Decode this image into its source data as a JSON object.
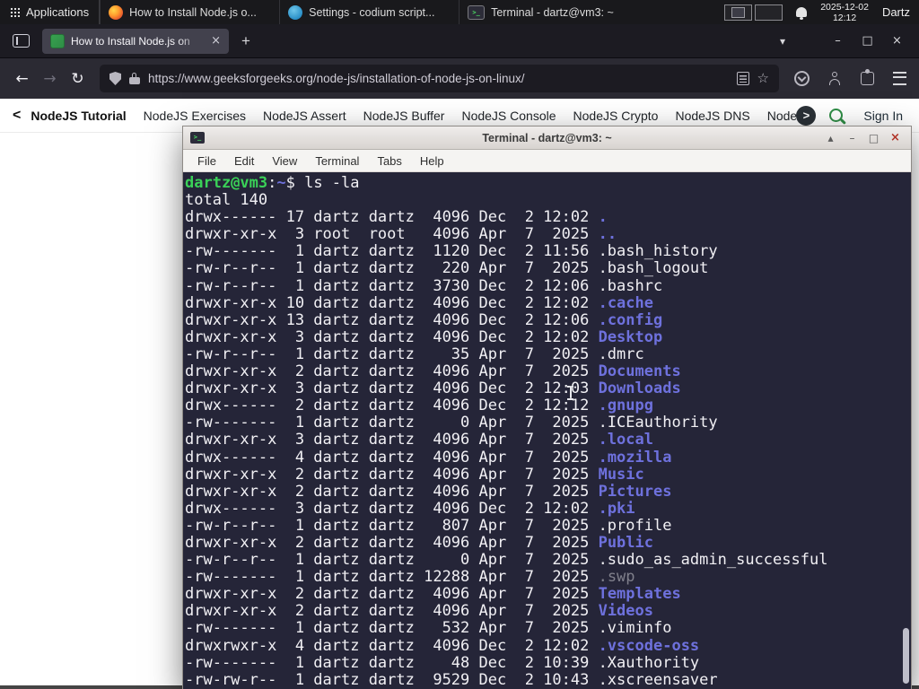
{
  "colors": {
    "accent_green": "#2f8d46",
    "terminal_bg": "#252538",
    "terminal_dir_blue": "#6e71dd",
    "terminal_prompt_green": "#3ad158",
    "panel_bg": "#19191c"
  },
  "icons": {
    "back": "←",
    "forward": "→",
    "reload": "↻",
    "star": "☆",
    "new_tab": "+",
    "tab_list": "▾",
    "minimize": "–",
    "restore": "□",
    "close": "×",
    "shade": "▴",
    "nav_prev": "<",
    "nav_next": ">",
    "prompt_glyph": ">_"
  },
  "top_panel": {
    "applications_label": "Applications",
    "tasks": [
      {
        "icon": "firefox",
        "label": "How to Install Node.js o..."
      },
      {
        "icon": "codium",
        "label": "Settings - codium script..."
      },
      {
        "icon": "terminal",
        "label": "Terminal - dartz@vm3: ~"
      }
    ],
    "clock_date": "2025-12-02",
    "clock_time": "12:12",
    "user": "Dartz"
  },
  "browser": {
    "tab_title": "How to Install Node.js on",
    "url": "https://www.geeksforgeeks.org/node-js/installation-of-node-js-on-linux/"
  },
  "site_nav": {
    "items": [
      "NodeJS Tutorial",
      "NodeJS Exercises",
      "NodeJS Assert",
      "NodeJS Buffer",
      "NodeJS Console",
      "NodeJS Crypto",
      "NodeJS DNS",
      "Node"
    ],
    "sign_in_label": "Sign In"
  },
  "terminal": {
    "title": "Terminal - dartz@vm3: ~",
    "menus": [
      "File",
      "Edit",
      "View",
      "Terminal",
      "Tabs",
      "Help"
    ],
    "lines": [
      [
        {
          "t": "dartz@vm3",
          "c": "green"
        },
        {
          "t": ":",
          "c": "fg"
        },
        {
          "t": "~",
          "c": "blue"
        },
        {
          "t": "$ ls -la",
          "c": "fg"
        }
      ],
      [
        {
          "t": "total 140",
          "c": "fg"
        }
      ],
      [
        {
          "t": "drwx------ 17 dartz dartz  4096 Dec  2 12:02 ",
          "c": "fg"
        },
        {
          "t": ".",
          "c": "dir"
        }
      ],
      [
        {
          "t": "drwxr-xr-x  3 root  root   4096 Apr  7  2025 ",
          "c": "fg"
        },
        {
          "t": "..",
          "c": "dir"
        }
      ],
      [
        {
          "t": "-rw-------  1 dartz dartz  1120 Dec  2 11:56 .bash_history",
          "c": "fg"
        }
      ],
      [
        {
          "t": "-rw-r--r--  1 dartz dartz   220 Apr  7  2025 .bash_logout",
          "c": "fg"
        }
      ],
      [
        {
          "t": "-rw-r--r--  1 dartz dartz  3730 Dec  2 12:06 .bashrc",
          "c": "fg"
        }
      ],
      [
        {
          "t": "drwxr-xr-x 10 dartz dartz  4096 Dec  2 12:02 ",
          "c": "fg"
        },
        {
          "t": ".cache",
          "c": "dir"
        }
      ],
      [
        {
          "t": "drwxr-xr-x 13 dartz dartz  4096 Dec  2 12:06 ",
          "c": "fg"
        },
        {
          "t": ".config",
          "c": "dir"
        }
      ],
      [
        {
          "t": "drwxr-xr-x  3 dartz dartz  4096 Dec  2 12:02 ",
          "c": "fg"
        },
        {
          "t": "Desktop",
          "c": "dir"
        }
      ],
      [
        {
          "t": "-rw-r--r--  1 dartz dartz    35 Apr  7  2025 .dmrc",
          "c": "fg"
        }
      ],
      [
        {
          "t": "drwxr-xr-x  2 dartz dartz  4096 Apr  7  2025 ",
          "c": "fg"
        },
        {
          "t": "Documents",
          "c": "dir"
        }
      ],
      [
        {
          "t": "drwxr-xr-x  3 dartz dartz  4096 Dec  2 12:03 ",
          "c": "fg"
        },
        {
          "t": "Downloads",
          "c": "dir"
        }
      ],
      [
        {
          "t": "drwx------  2 dartz dartz  4096 Dec  2 12:12 ",
          "c": "fg"
        },
        {
          "t": ".gnupg",
          "c": "dir"
        }
      ],
      [
        {
          "t": "-rw-------  1 dartz dartz     0 Apr  7  2025 .ICEauthority",
          "c": "fg"
        }
      ],
      [
        {
          "t": "drwxr-xr-x  3 dartz dartz  4096 Apr  7  2025 ",
          "c": "fg"
        },
        {
          "t": ".local",
          "c": "dir"
        }
      ],
      [
        {
          "t": "drwx------  4 dartz dartz  4096 Apr  7  2025 ",
          "c": "fg"
        },
        {
          "t": ".mozilla",
          "c": "dir"
        }
      ],
      [
        {
          "t": "drwxr-xr-x  2 dartz dartz  4096 Apr  7  2025 ",
          "c": "fg"
        },
        {
          "t": "Music",
          "c": "dir"
        }
      ],
      [
        {
          "t": "drwxr-xr-x  2 dartz dartz  4096 Apr  7  2025 ",
          "c": "fg"
        },
        {
          "t": "Pictures",
          "c": "dir"
        }
      ],
      [
        {
          "t": "drwx------  3 dartz dartz  4096 Dec  2 12:02 ",
          "c": "fg"
        },
        {
          "t": ".pki",
          "c": "dir"
        }
      ],
      [
        {
          "t": "-rw-r--r--  1 dartz dartz   807 Apr  7  2025 .profile",
          "c": "fg"
        }
      ],
      [
        {
          "t": "drwxr-xr-x  2 dartz dartz  4096 Apr  7  2025 ",
          "c": "fg"
        },
        {
          "t": "Public",
          "c": "dir"
        }
      ],
      [
        {
          "t": "-rw-r--r--  1 dartz dartz     0 Apr  7  2025 .sudo_as_admin_successful",
          "c": "fg"
        }
      ],
      [
        {
          "t": "-rw-------  1 dartz dartz 12288 Apr  7  2025 ",
          "c": "fg"
        },
        {
          "t": ".swp",
          "c": "dim"
        }
      ],
      [
        {
          "t": "drwxr-xr-x  2 dartz dartz  4096 Apr  7  2025 ",
          "c": "fg"
        },
        {
          "t": "Templates",
          "c": "dir"
        }
      ],
      [
        {
          "t": "drwxr-xr-x  2 dartz dartz  4096 Apr  7  2025 ",
          "c": "fg"
        },
        {
          "t": "Videos",
          "c": "dir"
        }
      ],
      [
        {
          "t": "-rw-------  1 dartz dartz   532 Apr  7  2025 .viminfo",
          "c": "fg"
        }
      ],
      [
        {
          "t": "drwxrwxr-x  4 dartz dartz  4096 Dec  2 12:02 ",
          "c": "fg"
        },
        {
          "t": ".vscode-oss",
          "c": "dir"
        }
      ],
      [
        {
          "t": "-rw-------  1 dartz dartz    48 Dec  2 10:39 .Xauthority",
          "c": "fg"
        }
      ],
      [
        {
          "t": "-rw-rw-r--  1 dartz dartz  9529 Dec  2 10:43 .xscreensaver",
          "c": "fg"
        }
      ]
    ]
  }
}
